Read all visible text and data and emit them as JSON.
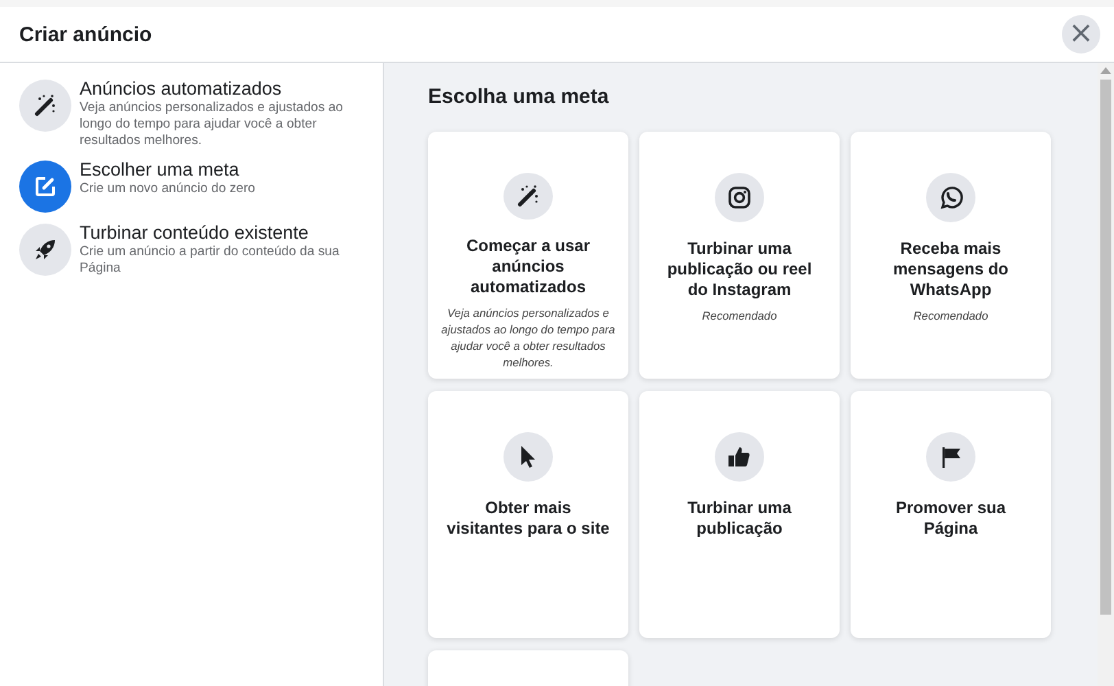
{
  "window": {
    "title": "Criar anúncio",
    "close": "×"
  },
  "sidebar": {
    "items": [
      {
        "title": "Anúncios automatizados",
        "description": "Veja anúncios personalizados e ajustados ao longo do tempo para ajudar você a obter resultados melhores.",
        "selected": false
      },
      {
        "title": "Escolher uma meta",
        "description": "Crie um novo anúncio do zero",
        "selected": true
      },
      {
        "title": "Turbinar conteúdo existente",
        "description": "Crie um anúncio a partir do conteúdo da sua Página",
        "selected": false
      }
    ]
  },
  "main": {
    "heading": "Escolha uma meta",
    "cards": [
      {
        "kind": "full",
        "title": "Começar a usar anúncios automatizados",
        "description": "Veja anúncios personalizados e ajustados ao longo do tempo para ajudar você a obter resultados melhores."
      },
      {
        "kind": "full",
        "title": "Turbinar uma publicação ou reel do Instagram",
        "description": "Recomendado"
      },
      {
        "kind": "full",
        "title": "Receba mais mensagens do WhatsApp",
        "description": "Recomendado"
      },
      {
        "kind": "full",
        "title": "Obter mais visitantes para o site"
      },
      {
        "kind": "full",
        "title": "Turbinar uma publicação"
      },
      {
        "kind": "full",
        "title": "Promover sua Página"
      },
      {
        "kind": "partial"
      }
    ]
  }
}
